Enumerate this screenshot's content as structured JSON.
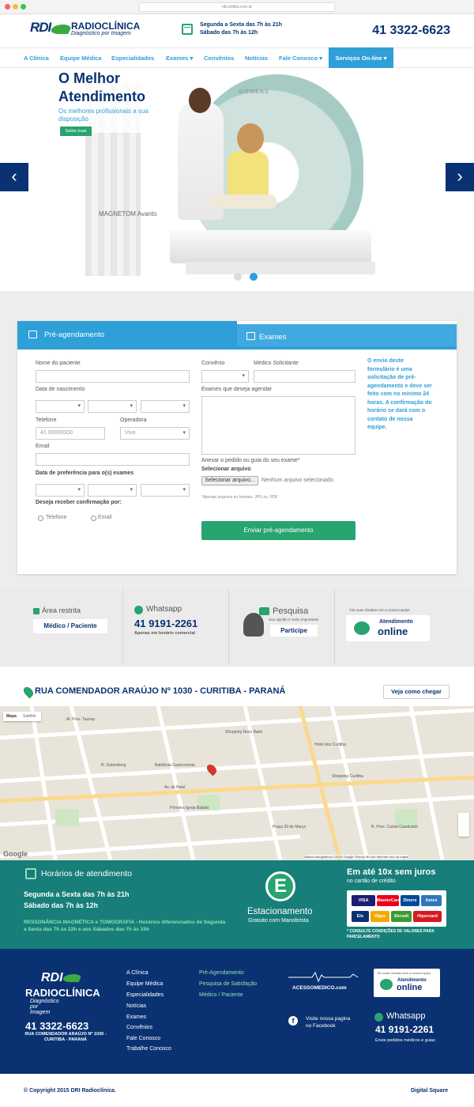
{
  "browser": {
    "url": "rdicuritiba.com.br"
  },
  "header": {
    "logo_mark": "RDI",
    "logo_name": "RADIOCLÍNICA",
    "logo_sub": "Diagnóstico por Imagem",
    "hours_week": "Segunda a Sexta das 7h às 21h",
    "hours_sat": "Sábado das 7h às 12h",
    "phone": "41 3322-6623"
  },
  "nav": {
    "items": [
      "A Clínica",
      "Equipe Médica",
      "Especialidades",
      "Exames ▾",
      "Convênios",
      "Notícias",
      "Fale Conosco ▾"
    ],
    "online": "Serviços On-line ▾"
  },
  "hero": {
    "title": "O Melhor Atendimento",
    "desc": "Os melhores profissionais a sua disposição",
    "button": "Saiba mais",
    "scanner_brand": "SIEMENS",
    "scanner_model": "MAGNETOM Avanto",
    "prev": "‹",
    "next": "›"
  },
  "form": {
    "tab_schedule": "Pré-agendamento",
    "tab_exams": "Exames",
    "patient_label": "Nome do paciente",
    "birth_label": "Data de nascimento",
    "phone_label": "Telefone",
    "phone_placeholder": "41 00000000",
    "carrier_label": "Operadora",
    "carrier_value": "Vivo",
    "email_label": "Email",
    "pref_date_label": "Data de preferência para o(s) exames",
    "confirm_label": "Deseja receber confirmação por:",
    "confirm_options": [
      "Telefone",
      "Email"
    ],
    "insurance_label": "Convênio",
    "doctor_label": "Médico Solicitante",
    "exams_label": "Exames que deseja agendar",
    "attach_label": "Anexar o pedido ou guia do seu exame*",
    "select_file_label": "Selecionar arquivo",
    "file_button": "Selecionar arquivo...",
    "file_status": "Nenhum arquivo selecionado.",
    "file_note": "*Apenas arquivos no formato .JPG ou .PDF",
    "submit": "Enviar pré-agendamento",
    "note": "O envio deste formulário é uma solicitação de pré-agendamento e deve ser feito com no mínimo 24 horas. A confirmação do horário se dará com o contato de nossa equipe."
  },
  "info": {
    "restricted_label": "Área restrita",
    "restricted_btn": "Médico / Paciente",
    "whatsapp_label": "Whatsapp",
    "whatsapp_number": "41 9191-2261",
    "whatsapp_note": "Apenas em horário comercial",
    "survey_label": "Pesquisa",
    "survey_note": "Sua opinião é muito importante!",
    "survey_btn": "Participe",
    "doubts_label": "Tire suas dúvidas com a nossa equipe",
    "online_small": "Atendimento",
    "online_big": "online"
  },
  "address": {
    "text": "RUA COMENDADOR ARAÚJO Nº 1030 - CURITIBA - PARANÁ",
    "route_btn": "Veja como chegar"
  },
  "map": {
    "type_map": "Mapa",
    "type_sat": "Satélite",
    "google": "Google",
    "footer": "Dados cartográficos ©2015 Google   Termos de Uso   Informar erro no mapa",
    "labels": [
      "Al. Pres. Taunay",
      "R. Gutemberg",
      "Shopping Novo Batel",
      "Babilônia Gastronomia",
      "Av. do Batel",
      "Primeira Igreja Batista",
      "Shopping Curitiba",
      "Hotel dos Curitiba",
      "R. Pres. Carlos Cavalcanti",
      "Praça 29 de Março"
    ]
  },
  "hours_band": {
    "title": "Horários de atendimento",
    "week": "Segunda a Sexta das 7h às 21h",
    "sat": "Sábado das 7h às 12h",
    "special": "RESSONÂNCIA MAGNÉTICA e TOMOGRAFIA - Horários diferenciados de Segunda a Sexta das 7h às 22h e aos Sábados das 7h às 15h",
    "parking_letter": "E",
    "parking_title": "Estacionamento",
    "parking_sub": "Gratuito com Manobrista",
    "installments_title": "Em até 10x sem juros",
    "installments_sub": "no cartão de crédito",
    "cards": [
      "VISA",
      "MasterCard",
      "Diners",
      "Amex",
      "Elo",
      "Hiper",
      "Sicredi",
      "Hipercard"
    ],
    "conditions": "* CONSULTE CONDIÇÕES DE VALORES PARA PARCELAMENTO"
  },
  "footer": {
    "phone": "41 3322-6623",
    "address": "RUA COMENDADOR ARAÚJO Nº 1030 - CURITIBA - PARANÁ",
    "links1": [
      "A Clínica",
      "Equipe Médica",
      "Especialidades",
      "Notícias",
      "Exames",
      "Convênios",
      "Fale Conosco",
      "Trabalhe Conosco"
    ],
    "links2": [
      "Pré-Agendamento",
      "Pesquisa de Satisfação",
      "Médico / Paciente"
    ],
    "acesso": "ACESSOMEDICO.com",
    "fb_line1": "Visite nossa pagina",
    "fb_line2": "no Facebook",
    "doubts": "Tire suas dúvidas com a nossa equipe",
    "online_small": "Atendimento",
    "online_big": "online",
    "whatsapp_label": "Whatsapp",
    "whatsapp_number": "41 9191-2261",
    "whatsapp_note": "Envie pedidos médicos e guias",
    "copyright": "© Copyright 2015 DRI Radioclínica.",
    "credit": "Digital Square"
  },
  "colors": {
    "navy": "#0a3272",
    "blue": "#2f9fd8",
    "green": "#27a46f",
    "teal": "#177e79"
  }
}
